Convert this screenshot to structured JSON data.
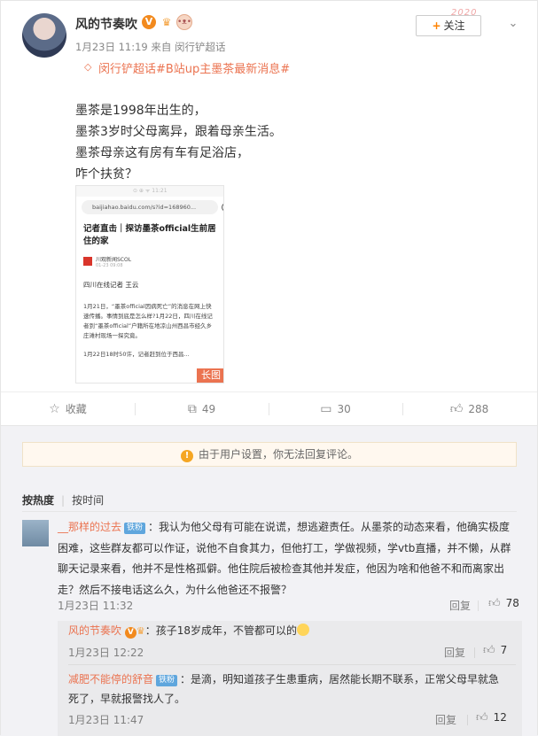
{
  "post": {
    "author": "风的节奏吹",
    "follow_label": "关注",
    "decoration_text": "2020",
    "meta": "1月23日 11:19 来自 闵行铲超话",
    "topic": "闵行铲超话#B站up主墨茶最新消息#",
    "lines": [
      "墨茶是1998年出生的，",
      "墨茶3岁时父母离异，跟着母亲生活。",
      "墨茶母亲这有房有车有足浴店，",
      "咋个扶贫？"
    ],
    "thumbnail": {
      "status": "⊙ ⊕ ᯤ 11:21",
      "url": "baijiahao.baidu.com/s?id=168960...",
      "title": "记者直击｜探访墨茶official生前居住的家",
      "source_name": "川观新闻SCOL",
      "source_time": "01-23 09:08",
      "reporter": "四川在线记者 王云",
      "para1": "1月21日，“墨茶official因病死亡”的消息在网上快速传播。事情到底是怎么样?1月22日，四川在线记者到“墨茶official”户籍所在地凉山州西昌市经久乡庄滩村现场一探究竟。",
      "para2": "1月22日18时50许，记者赶到位于西昌...",
      "badge": "长图"
    }
  },
  "actions": {
    "favorite": "收藏",
    "repost_count": "49",
    "comment_count": "30",
    "like_count": "288"
  },
  "comments": {
    "notice": "由于用户设置，你无法回复评论。",
    "sort_hot": "按热度",
    "sort_time": "按时间",
    "items": [
      {
        "user": "__那样的过去",
        "badge": "铁粉",
        "text": "：我认为他父母有可能在说谎，想逃避责任。从墨茶的动态来看，他确实极度困难，这些群友都可以作证，说他不自食其力，但他打工，学做视频，学vtb直播，并不懒，从群聊天记录来看，他并不是性格孤僻。他住院后被检查其他并发症，他因为啥和他爸不和而离家出走？然后不接电话这么久，为什么他爸还不报警？",
        "date": "1月23日 11:32",
        "reply_label": "回复",
        "likes": "78"
      }
    ],
    "replies": [
      {
        "user": "风的节奏吹",
        "text": "：孩子18岁成年，不管都可以的",
        "date": "1月23日 12:22",
        "reply_label": "回复",
        "likes": "7"
      },
      {
        "user": "减肥不能停的舒音",
        "badge": "铁粉",
        "text": "：是滴，明知道孩子生患重病，居然能长期不联系，正常父母早就急死了，早就报警找人了。",
        "date": "1月23日 11:47",
        "reply_label": "回复",
        "likes": "12"
      }
    ]
  }
}
